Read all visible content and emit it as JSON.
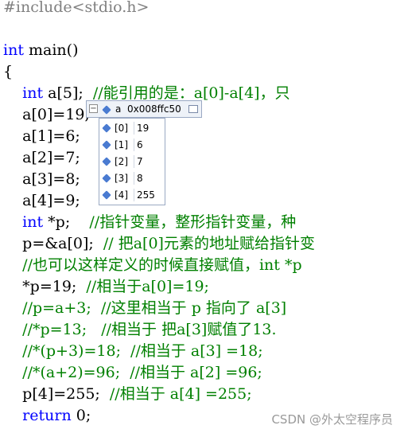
{
  "code_lines": [
    [
      {
        "t": "#include<stdio.h>",
        "c": "pp"
      }
    ],
    [],
    [
      {
        "t": "int",
        "c": "kw"
      },
      {
        "t": " main()",
        "c": "id"
      }
    ],
    [
      {
        "t": "{",
        "c": "id"
      }
    ],
    [
      {
        "t": "    ",
        "c": "id"
      },
      {
        "t": "int",
        "c": "kw"
      },
      {
        "t": " a[5];  ",
        "c": "id"
      },
      {
        "t": "//能引用的是：a[0]-a[4]，只",
        "c": "cm"
      }
    ],
    [
      {
        "t": "    a[0]=19;",
        "c": "id"
      }
    ],
    [
      {
        "t": "    a[1]=6;",
        "c": "id"
      }
    ],
    [
      {
        "t": "    a[2]=7;",
        "c": "id"
      }
    ],
    [
      {
        "t": "    a[3]=8;",
        "c": "id"
      }
    ],
    [
      {
        "t": "    a[4]=9;",
        "c": "id"
      }
    ],
    [
      {
        "t": "    ",
        "c": "id"
      },
      {
        "t": "int",
        "c": "kw"
      },
      {
        "t": " *p;    ",
        "c": "id"
      },
      {
        "t": "//指针变量，整形指针变量，种",
        "c": "cm"
      }
    ],
    [
      {
        "t": "    p=&a[0];  ",
        "c": "id"
      },
      {
        "t": "// 把a[0]元素的地址赋给指针变",
        "c": "cm"
      }
    ],
    [
      {
        "t": "    ",
        "c": "id"
      },
      {
        "t": "//也可以这样定义的时候直接赋值，int *p",
        "c": "cm"
      }
    ],
    [
      {
        "t": "    *p=19;  ",
        "c": "id"
      },
      {
        "t": "//相当于a[0]=19;",
        "c": "cm"
      }
    ],
    [
      {
        "t": "    ",
        "c": "id"
      },
      {
        "t": "//p=a+3;  //这里相当于 p 指向了 a[3]",
        "c": "cm"
      }
    ],
    [
      {
        "t": "    ",
        "c": "id"
      },
      {
        "t": "//*p=13;   //相当于 把a[3]赋值了13.",
        "c": "cm"
      }
    ],
    [
      {
        "t": "    ",
        "c": "id"
      },
      {
        "t": "//*(p+3)=18;  //相当于 a[3] =18;",
        "c": "cm"
      }
    ],
    [
      {
        "t": "    ",
        "c": "id"
      },
      {
        "t": "//*(a+2)=96;  //相当于 a[2] =96;",
        "c": "cm"
      }
    ],
    [
      {
        "t": "    p[4]=255;  ",
        "c": "id"
      },
      {
        "t": "//相当于 a[4] =255;",
        "c": "cm"
      }
    ],
    [
      {
        "t": "    ",
        "c": "id"
      },
      {
        "t": "return",
        "c": "kw"
      },
      {
        "t": " 0;",
        "c": "id"
      }
    ]
  ],
  "debugger": {
    "var_name": "a",
    "var_value": "0x008ffc50",
    "expander_glyph": "−",
    "items": [
      {
        "index": "[0]",
        "value": "19"
      },
      {
        "index": "[1]",
        "value": "6"
      },
      {
        "index": "[2]",
        "value": "7"
      },
      {
        "index": "[3]",
        "value": "8"
      },
      {
        "index": "[4]",
        "value": "255"
      }
    ]
  },
  "watermark": "CSDN @外太空程序员",
  "colors": {
    "keyword": "#0000ff",
    "comment": "#008000",
    "preprocessor": "#808080"
  }
}
